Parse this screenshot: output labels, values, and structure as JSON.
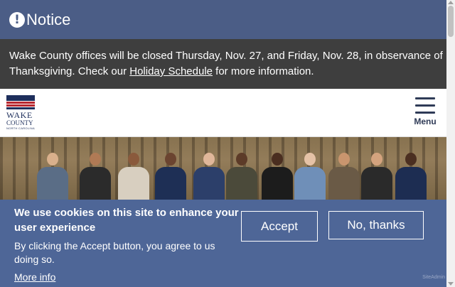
{
  "notice": {
    "icon": "exclamation-circle-icon",
    "title": "Notice",
    "message_before": "Wake County offices will be closed Thursday, Nov. 27, and Friday, Nov. 28, in observance of Thanksgiving. Check our ",
    "link_text": "Holiday Schedule",
    "message_after": " for more information."
  },
  "header": {
    "logo_line1": "WAKE",
    "logo_line2": "COUNTY",
    "logo_line3": "NORTH CAROLINA",
    "menu_label": "Menu",
    "menu_icon": "hamburger-icon"
  },
  "cookie_banner": {
    "title": "We use cookies on this site to enhance your user experience",
    "text": "By clicking the Accept button, you agree to us doing so.",
    "more_info": "More info",
    "accept_label": "Accept",
    "decline_label": "No, thanks",
    "powered_by": "SiteAdmin"
  },
  "colors": {
    "notice_header_bg": "#4b5d86",
    "notice_body_bg": "#3e3e3e",
    "cookie_bg": "#4e6697",
    "menu_color": "#2f3b57"
  }
}
